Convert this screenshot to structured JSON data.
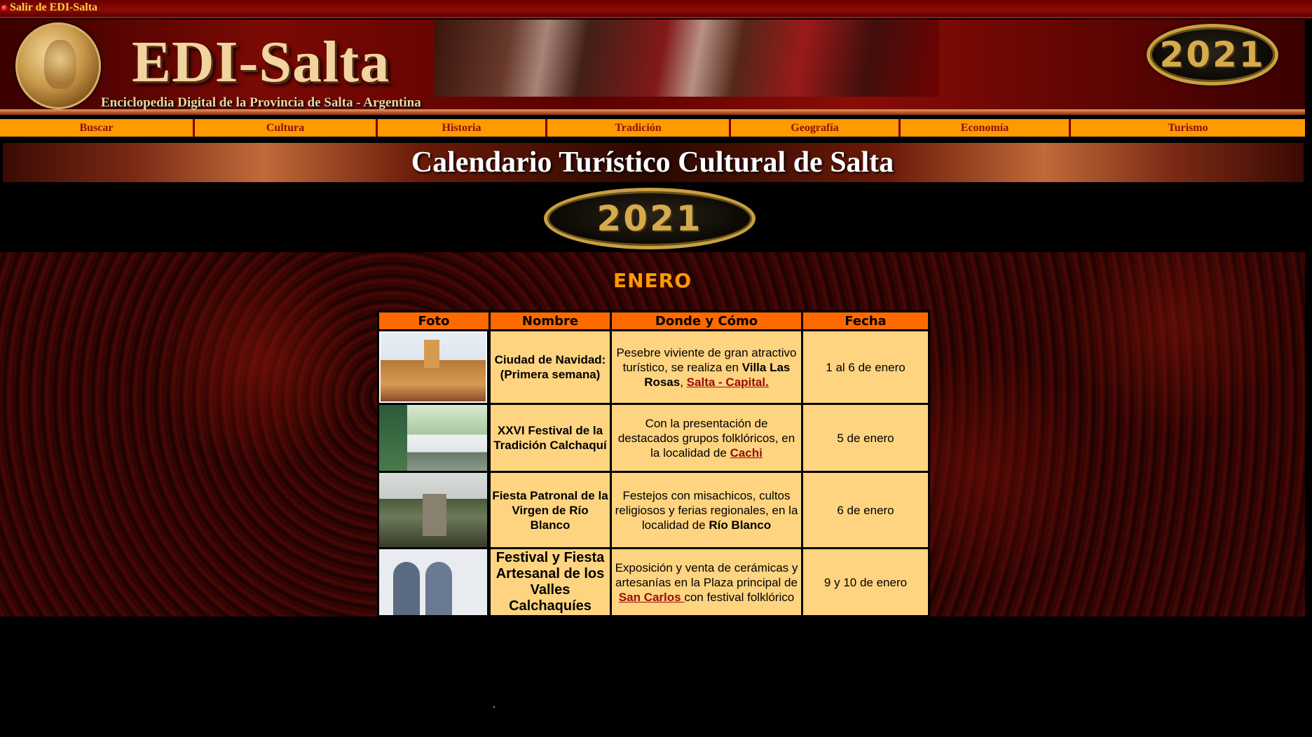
{
  "topbar": {
    "exit_label": "Salir de EDI-Salta"
  },
  "banner": {
    "logo_title": "EDI-Salta",
    "logo_subtitle": "Enciclopedia Digital de la Provincia de Salta - Argentina",
    "year": "2021"
  },
  "nav": {
    "items": [
      {
        "label": "Buscar"
      },
      {
        "label": "Cultura"
      },
      {
        "label": "Historia"
      },
      {
        "label": "Tradición"
      },
      {
        "label": "Geografía"
      },
      {
        "label": "Economía"
      },
      {
        "label": "Turismo"
      }
    ]
  },
  "page": {
    "title": "Calendario Turístico Cultural de Salta",
    "year": "2021",
    "month": "ENERO"
  },
  "table": {
    "headers": [
      "Foto",
      "Nombre",
      "Donde y Cómo",
      "Fecha"
    ],
    "rows": [
      {
        "name": "Ciudad de Navidad: (Primera semana)",
        "desc_pre": "Pesebre viviente de gran atractivo turístico, se realiza en ",
        "desc_bold": "Villa Las Rosas",
        "desc_mid": ", ",
        "desc_link": "Salta - Capital.",
        "date": "1 al 6 de enero"
      },
      {
        "name": "XXVI Festival de la Tradición Calchaquí",
        "desc_pre": "Con la presentación de destacados grupos folklóricos, en la localidad de ",
        "desc_link": "Cachi",
        "date": "5 de enero"
      },
      {
        "name": "Fiesta Patronal de la Virgen de Río Blanco",
        "desc_pre": "Festejos con misachicos, cultos religiosos y ferias regionales, en la localidad de ",
        "desc_bold": "Río Blanco",
        "date": "6 de enero"
      },
      {
        "name": "Festival y Fiesta Artesanal de los Valles Calchaquíes",
        "desc_pre": "Exposición y venta de cerámicas y artesanías en la Plaza principal de ",
        "desc_link": "San Carlos ",
        "desc_post": "con festival folklórico",
        "date": "9 y 10 de enero"
      }
    ]
  },
  "colors": {
    "nav_bg": "#ff9a00",
    "header_bg": "#ff6a00",
    "cell_bg": "#ffd480",
    "month_color": "#ff9a00",
    "link_color": "#9a0a0a"
  }
}
